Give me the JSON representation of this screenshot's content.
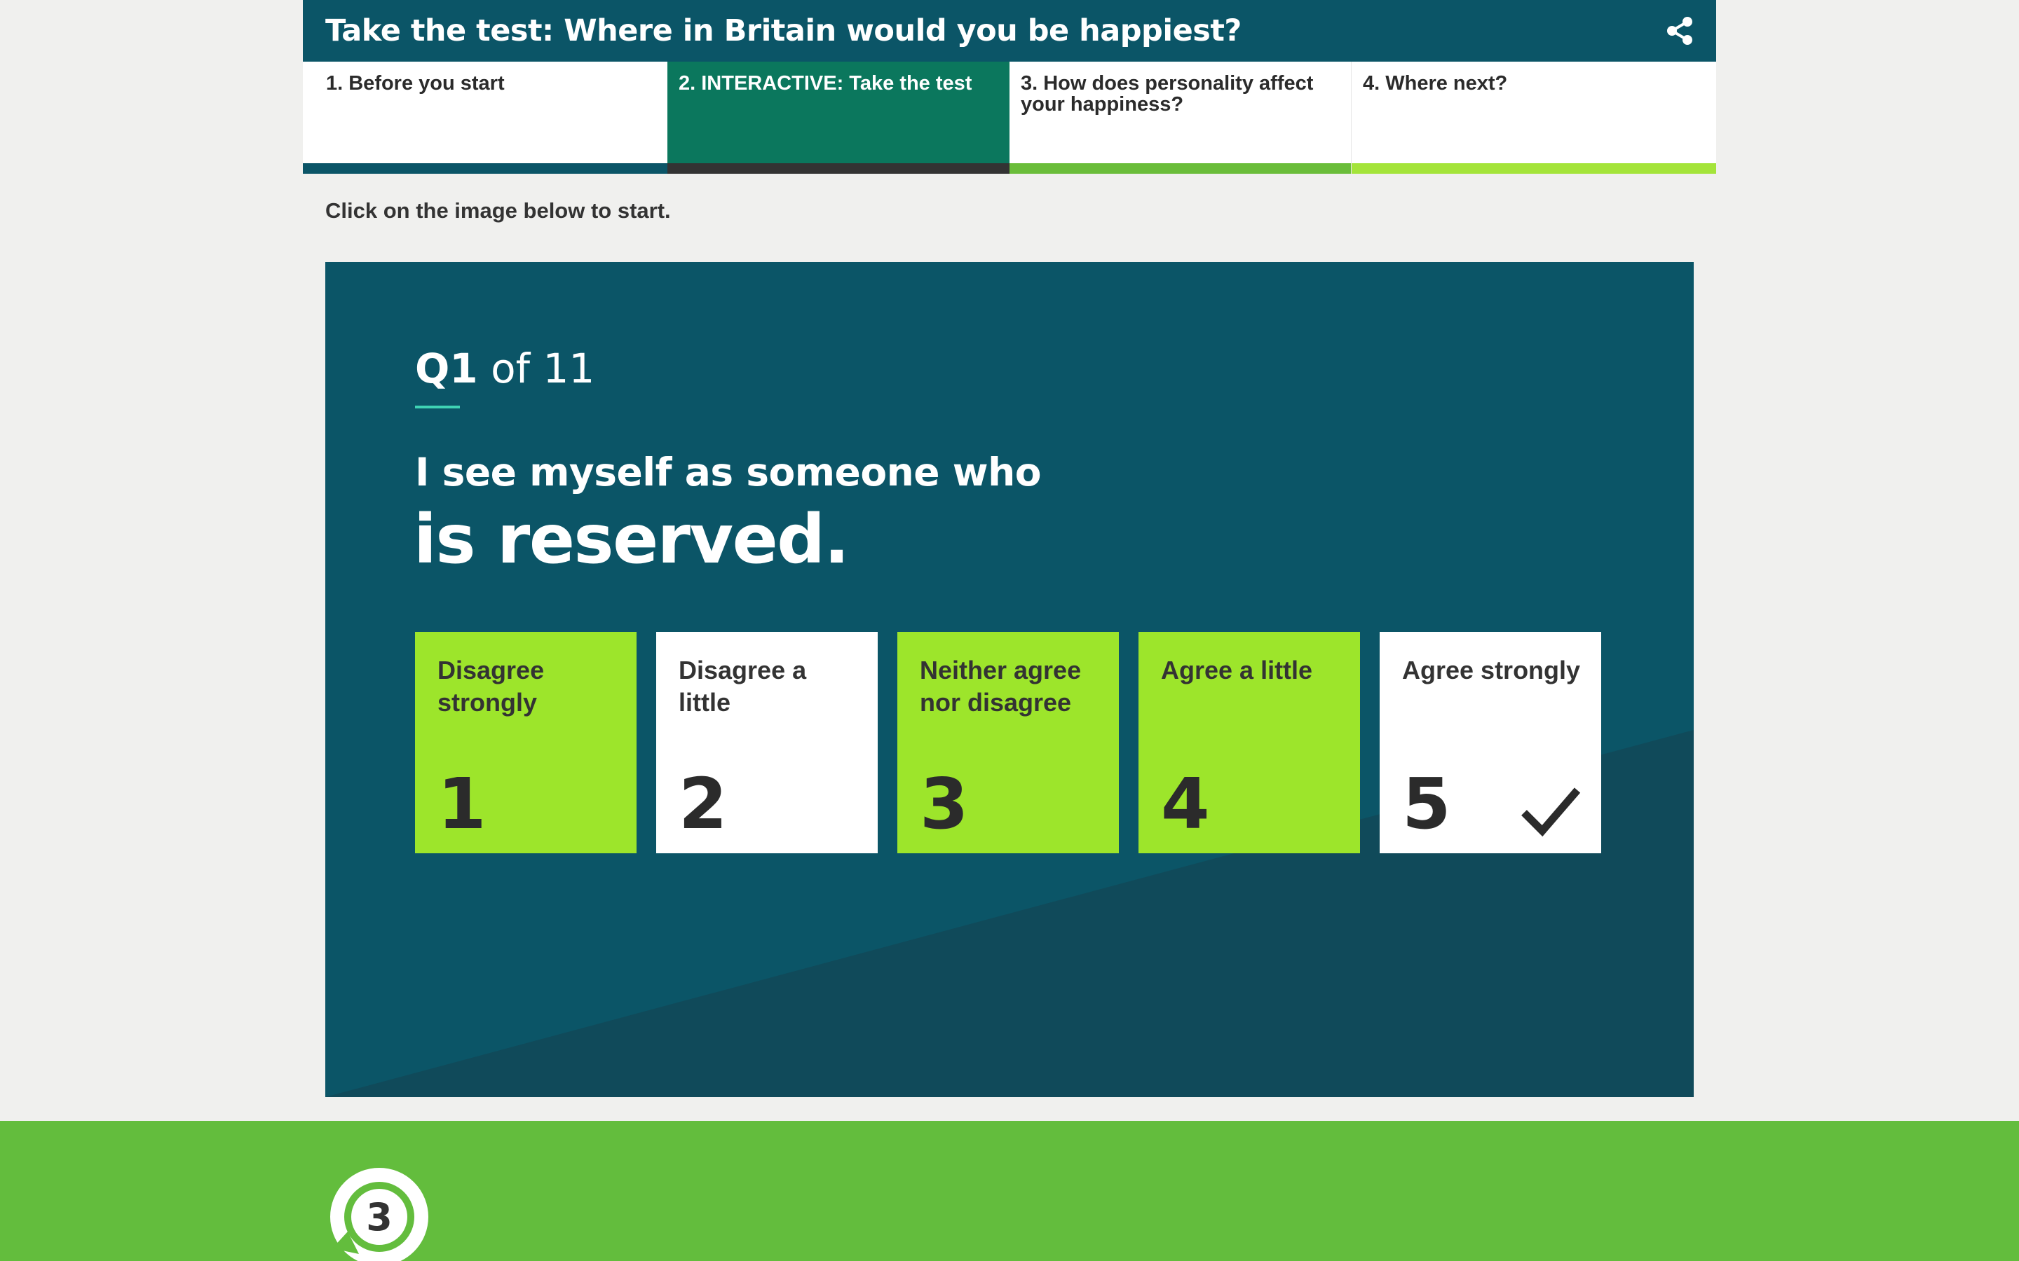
{
  "header": {
    "title": "Take the test: Where in Britain would you be happiest?",
    "share_icon": "share-icon"
  },
  "tabs": [
    {
      "label": "1. Before you start",
      "active": false
    },
    {
      "label": "2. INTERACTIVE: Take the test",
      "active": true
    },
    {
      "label": "3. How does personality affect your happiness?",
      "active": false
    },
    {
      "label": "4. Where next?",
      "active": false
    }
  ],
  "instruction": "Click on the image below to start.",
  "quiz": {
    "question_number": "Q1",
    "question_total": "of 11",
    "lead": "I see myself as someone who",
    "statement": "is reserved.",
    "options": [
      {
        "label": "Disagree strongly",
        "number": "1",
        "style": "green",
        "selected": false
      },
      {
        "label": "Disagree a little",
        "number": "2",
        "style": "white",
        "selected": false
      },
      {
        "label": "Neither agree nor disagree",
        "number": "3",
        "style": "green",
        "selected": false
      },
      {
        "label": "Agree a little",
        "number": "4",
        "style": "green",
        "selected": false
      },
      {
        "label": "Agree strongly",
        "number": "5",
        "style": "white",
        "selected": true
      }
    ]
  },
  "footer": {
    "logo_text": "3",
    "logo_icon": "bbc-three-logo"
  },
  "colors": {
    "header_bg": "#0b5567",
    "active_tab": "#0b775d",
    "option_green": "#9de52b",
    "footer_bg": "#63bd3d",
    "accent_teal": "#3fd3b4"
  }
}
